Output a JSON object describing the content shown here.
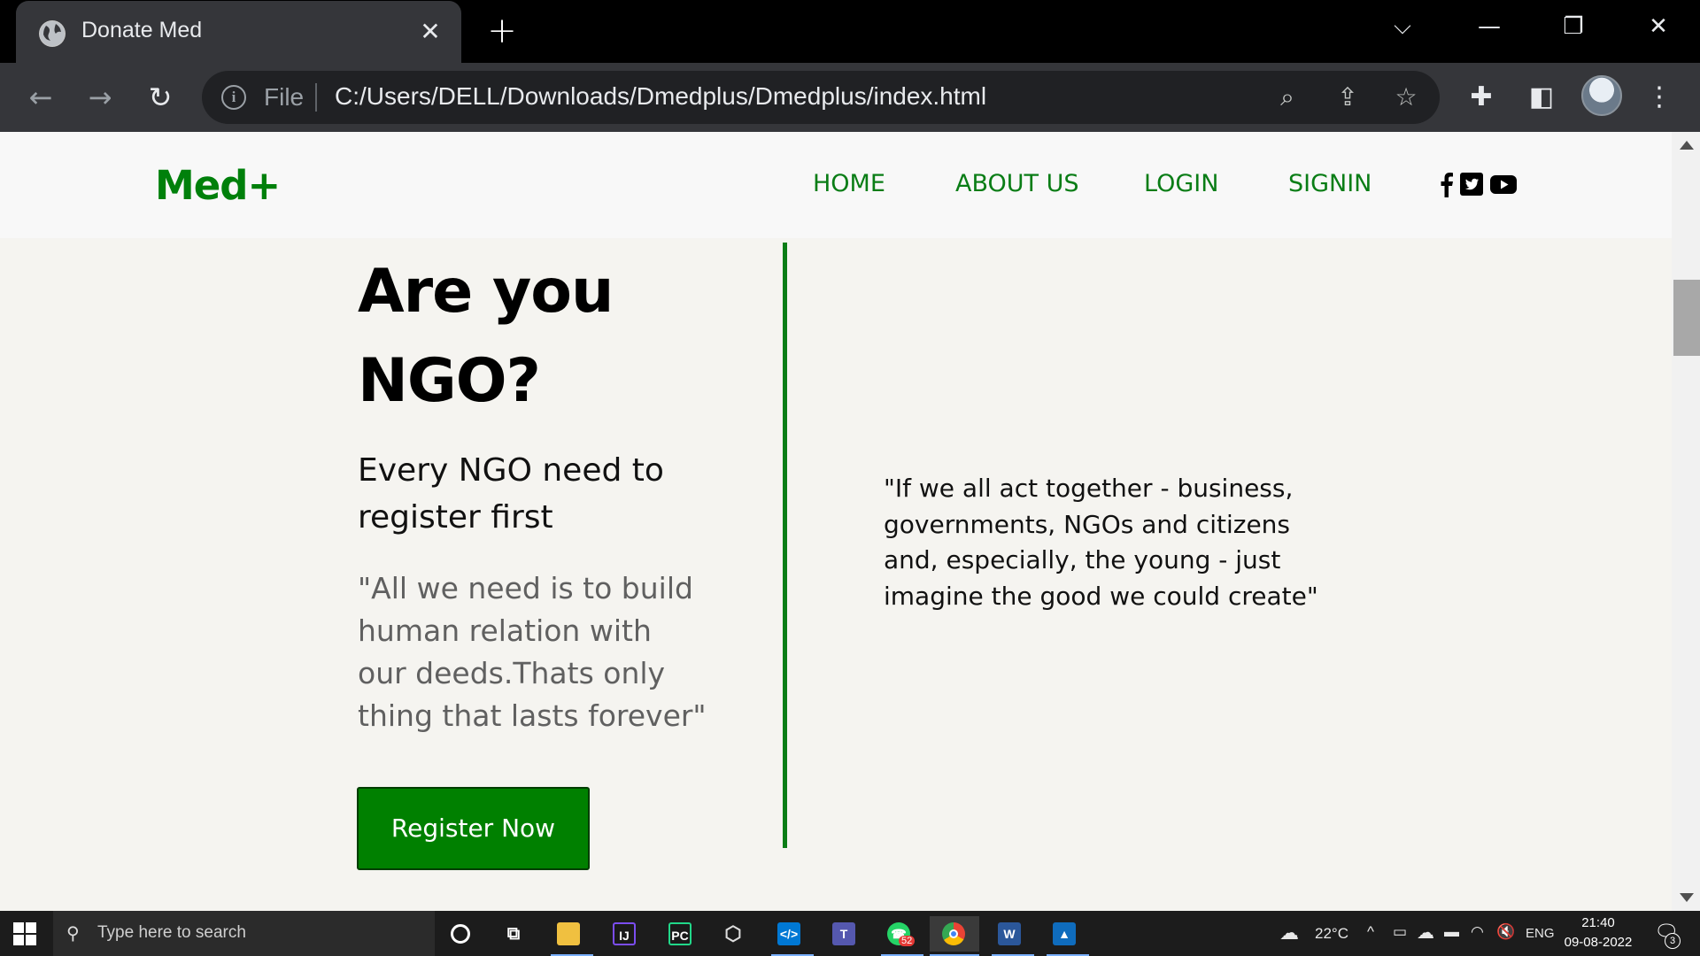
{
  "browser": {
    "tab_title": "Donate Med",
    "tab_close": "✕",
    "new_tab": "+",
    "url_scheme_label": "File",
    "url": "C:/Users/DELL/Downloads/Dmedplus/Dmedplus/index.html"
  },
  "site": {
    "logo": "Med+",
    "nav": [
      "HOME",
      "ABOUT US",
      "LOGIN",
      "SIGNIN"
    ],
    "social_icons": [
      "facebook-icon",
      "twitter-icon",
      "youtube-icon"
    ],
    "brand_color": "#0a7d16"
  },
  "main": {
    "heading_line1": "Are you",
    "heading_line2": "NGO?",
    "subtitle_line1": "Every NGO need to",
    "subtitle_line2": "register first",
    "quote_left_lines": [
      "\"All we need is to build",
      "human relation with",
      "our deeds.Thats only",
      "thing that lasts forever\""
    ],
    "register_button": "Register Now",
    "quote_right_lines": [
      "\"If we all act together - business,",
      "governments, NGOs and citizens",
      "and, especially, the young - just",
      "imagine the good we could create\""
    ]
  },
  "taskbar": {
    "search_placeholder": "Type here to search",
    "whatsapp_badge": "52",
    "weather": "22°C",
    "language": "ENG",
    "time": "21:40",
    "date": "09-08-2022",
    "notification_count": "3"
  }
}
